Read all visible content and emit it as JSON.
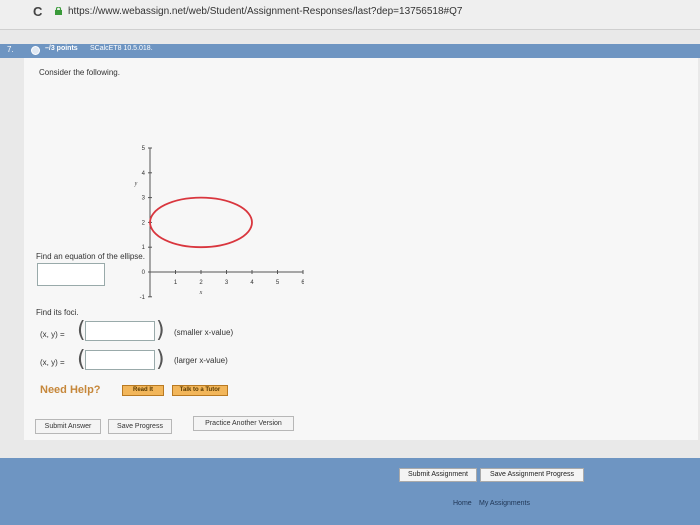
{
  "browser": {
    "url": "https://www.webassign.net/web/Student/Assignment-Responses/last?dep=13756518#Q7",
    "reload_icon": "reload-icon",
    "lock_icon": "lock-icon"
  },
  "question": {
    "number": "7.",
    "points": "–/3 points",
    "source": "SCalcET8 10.5.018.",
    "prompt": "Consider the following.",
    "find_equation": "Find an equation of the ellipse.",
    "find_foci": "Find its foci.",
    "focus_label": "(x, y) =",
    "smaller_hint": "(smaller x-value)",
    "larger_hint": "(larger x-value)"
  },
  "help": {
    "label": "Need Help?",
    "read_it": "Read It",
    "talk_to_tutor": "Talk to a Tutor"
  },
  "actions": {
    "submit_answer": "Submit Answer",
    "save_progress": "Save Progress",
    "practice_another": "Practice Another Version"
  },
  "footer": {
    "submit_assignment": "Submit Assignment",
    "save_assignment_progress": "Save Assignment Progress",
    "home": "Home",
    "my_assignments": "My Assignments"
  },
  "graph": {
    "x_axis_label": "x",
    "y_axis_label": "y",
    "x_ticks": [
      "1",
      "2",
      "3",
      "4",
      "5",
      "6"
    ],
    "y_ticks": [
      "-1",
      "0",
      "1",
      "2",
      "3",
      "4",
      "5"
    ],
    "ellipse": {
      "center_x": 2,
      "center_y": 2,
      "semi_axis_x": 2,
      "semi_axis_y": 1
    },
    "xlim": [
      0,
      6
    ],
    "ylim": [
      -1,
      5
    ],
    "ellipse_color": "#d9363e",
    "axis_color": "#555555"
  }
}
